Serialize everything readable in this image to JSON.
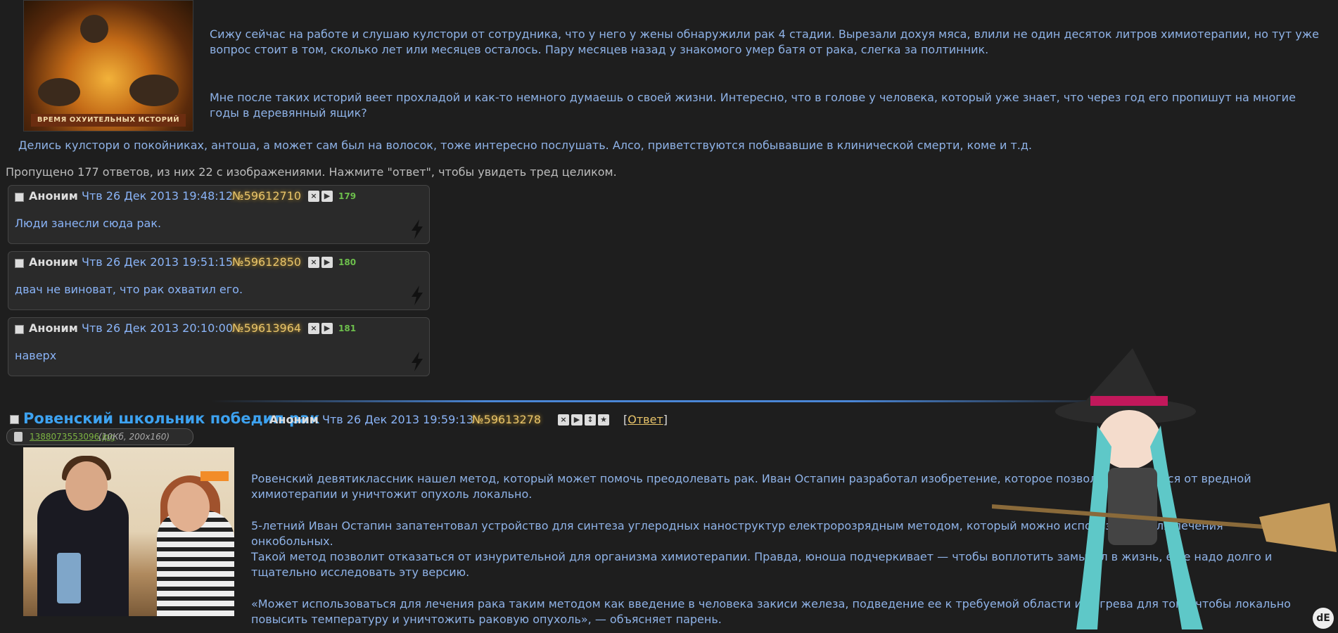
{
  "op": {
    "image_caption": "ВРЕМЯ ОХУИТЕЛЬНЫХ ИСТОРИЙ",
    "paragraph1": "Сижу сейчас на работе и слушаю кулстори от сотрудника, что у него у жены обнаружили рак 4 стадии. Вырезали дохуя мяса, влили не один десяток литров химиотерапии, но тут уже вопрос стоит в том, сколько лет или месяцев осталось. Пару месяцев назад у знакомого умер батя от рака, слегка за полтинник.",
    "paragraph2": "Мне после таких историй веет прохладой и как-то немного думаешь о своей жизни. Интересно, что в голове у человека, который уже знает, что через год его пропишут на многие годы в деревянный ящик?",
    "paragraph3": "Делись кулстори о покойниках, антоша, а может сам был на волосок, тоже интересно послушать. Алсо, приветствуются побывавшие в клинической смерти, коме и т.д."
  },
  "omitted": "Пропущено 177 ответов, из них 22 с изображениями. Нажмите \"ответ\", чтобы увидеть тред целиком.",
  "replies": [
    {
      "name": "Аноним",
      "date": "Чтв 26 Дек 2013 19:48:12",
      "num": "№59612710",
      "count": "179",
      "text": "Люди занесли сюда рак."
    },
    {
      "name": "Аноним",
      "date": "Чтв 26 Дек 2013 19:51:15",
      "num": "№59612850",
      "count": "180",
      "text": "двач не виноват, что рак охватил его."
    },
    {
      "name": "Аноним",
      "date": "Чтв 26 Дек 2013 20:10:00",
      "num": "№59613964",
      "count": "181",
      "text": "наверх"
    }
  ],
  "thread2": {
    "title": "Ровенский школьник победил рак",
    "name": "Аноним",
    "date": "Чтв 26 Дек 2013 19:59:13",
    "num": "№59613278",
    "reply_open": "[",
    "reply_label": "Ответ",
    "reply_close": "]",
    "file_name": "1388073553096.jpg",
    "file_info": "(10Кб, 200x160)",
    "paragraphs": [
      "Ровенский девятиклассник нашел метод, который может помочь преодолевать рак. Иван Остапин разработал изобретение, которое позволит отказаться от вредной химиотерапии и уничтожит опухоль локально.",
      "5-летний Иван Остапин запатентовал устройство для синтеза углеродных наноструктур електророзрядным методом, который можно использовать для лечения онкобольных.",
      "Такой метод позволит отказаться от изнурительной для организма химиотерапии. Правда, юноша подчеркивает — чтобы воплотить замысел в жизнь, еще надо долго и тщательно исследовать эту версию.",
      "«Может использоваться для лечения рака таким методом как введение в человека закиси железа, подведение ее к требуемой области и нагрева для того, чтобы локально повысить температуру и уничтожить раковую опухоль», — объясняет парень."
    ]
  },
  "icons": {
    "hide": "×",
    "play": "▶",
    "sort": "↕",
    "star": "★",
    "corner": "dE"
  }
}
